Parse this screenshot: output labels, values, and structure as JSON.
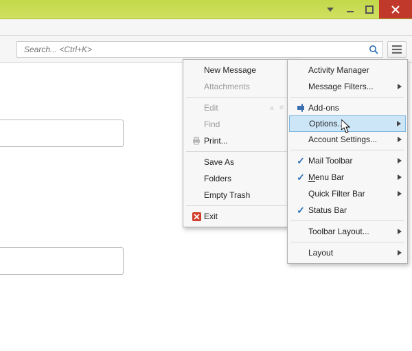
{
  "search": {
    "placeholder": "Search... <Ctrl+K>"
  },
  "menu1": {
    "new_message": "New Message",
    "attachments": "Attachments",
    "edit": "Edit",
    "find": "Find",
    "print": "Print...",
    "save_as": "Save As",
    "folders": "Folders",
    "empty_trash": "Empty Trash",
    "exit": "Exit"
  },
  "menu2": {
    "activity_manager": "Activity Manager",
    "message_filters": "Message Filters...",
    "addons": "Add-ons",
    "options": "Options...",
    "account_settings": "Account Settings...",
    "mail_toolbar": "Mail Toolbar",
    "menu_bar": "Menu Bar",
    "quick_filter_bar": "Quick Filter Bar",
    "status_bar": "Status Bar",
    "toolbar_layout": "Toolbar Layout...",
    "layout": "Layout"
  }
}
